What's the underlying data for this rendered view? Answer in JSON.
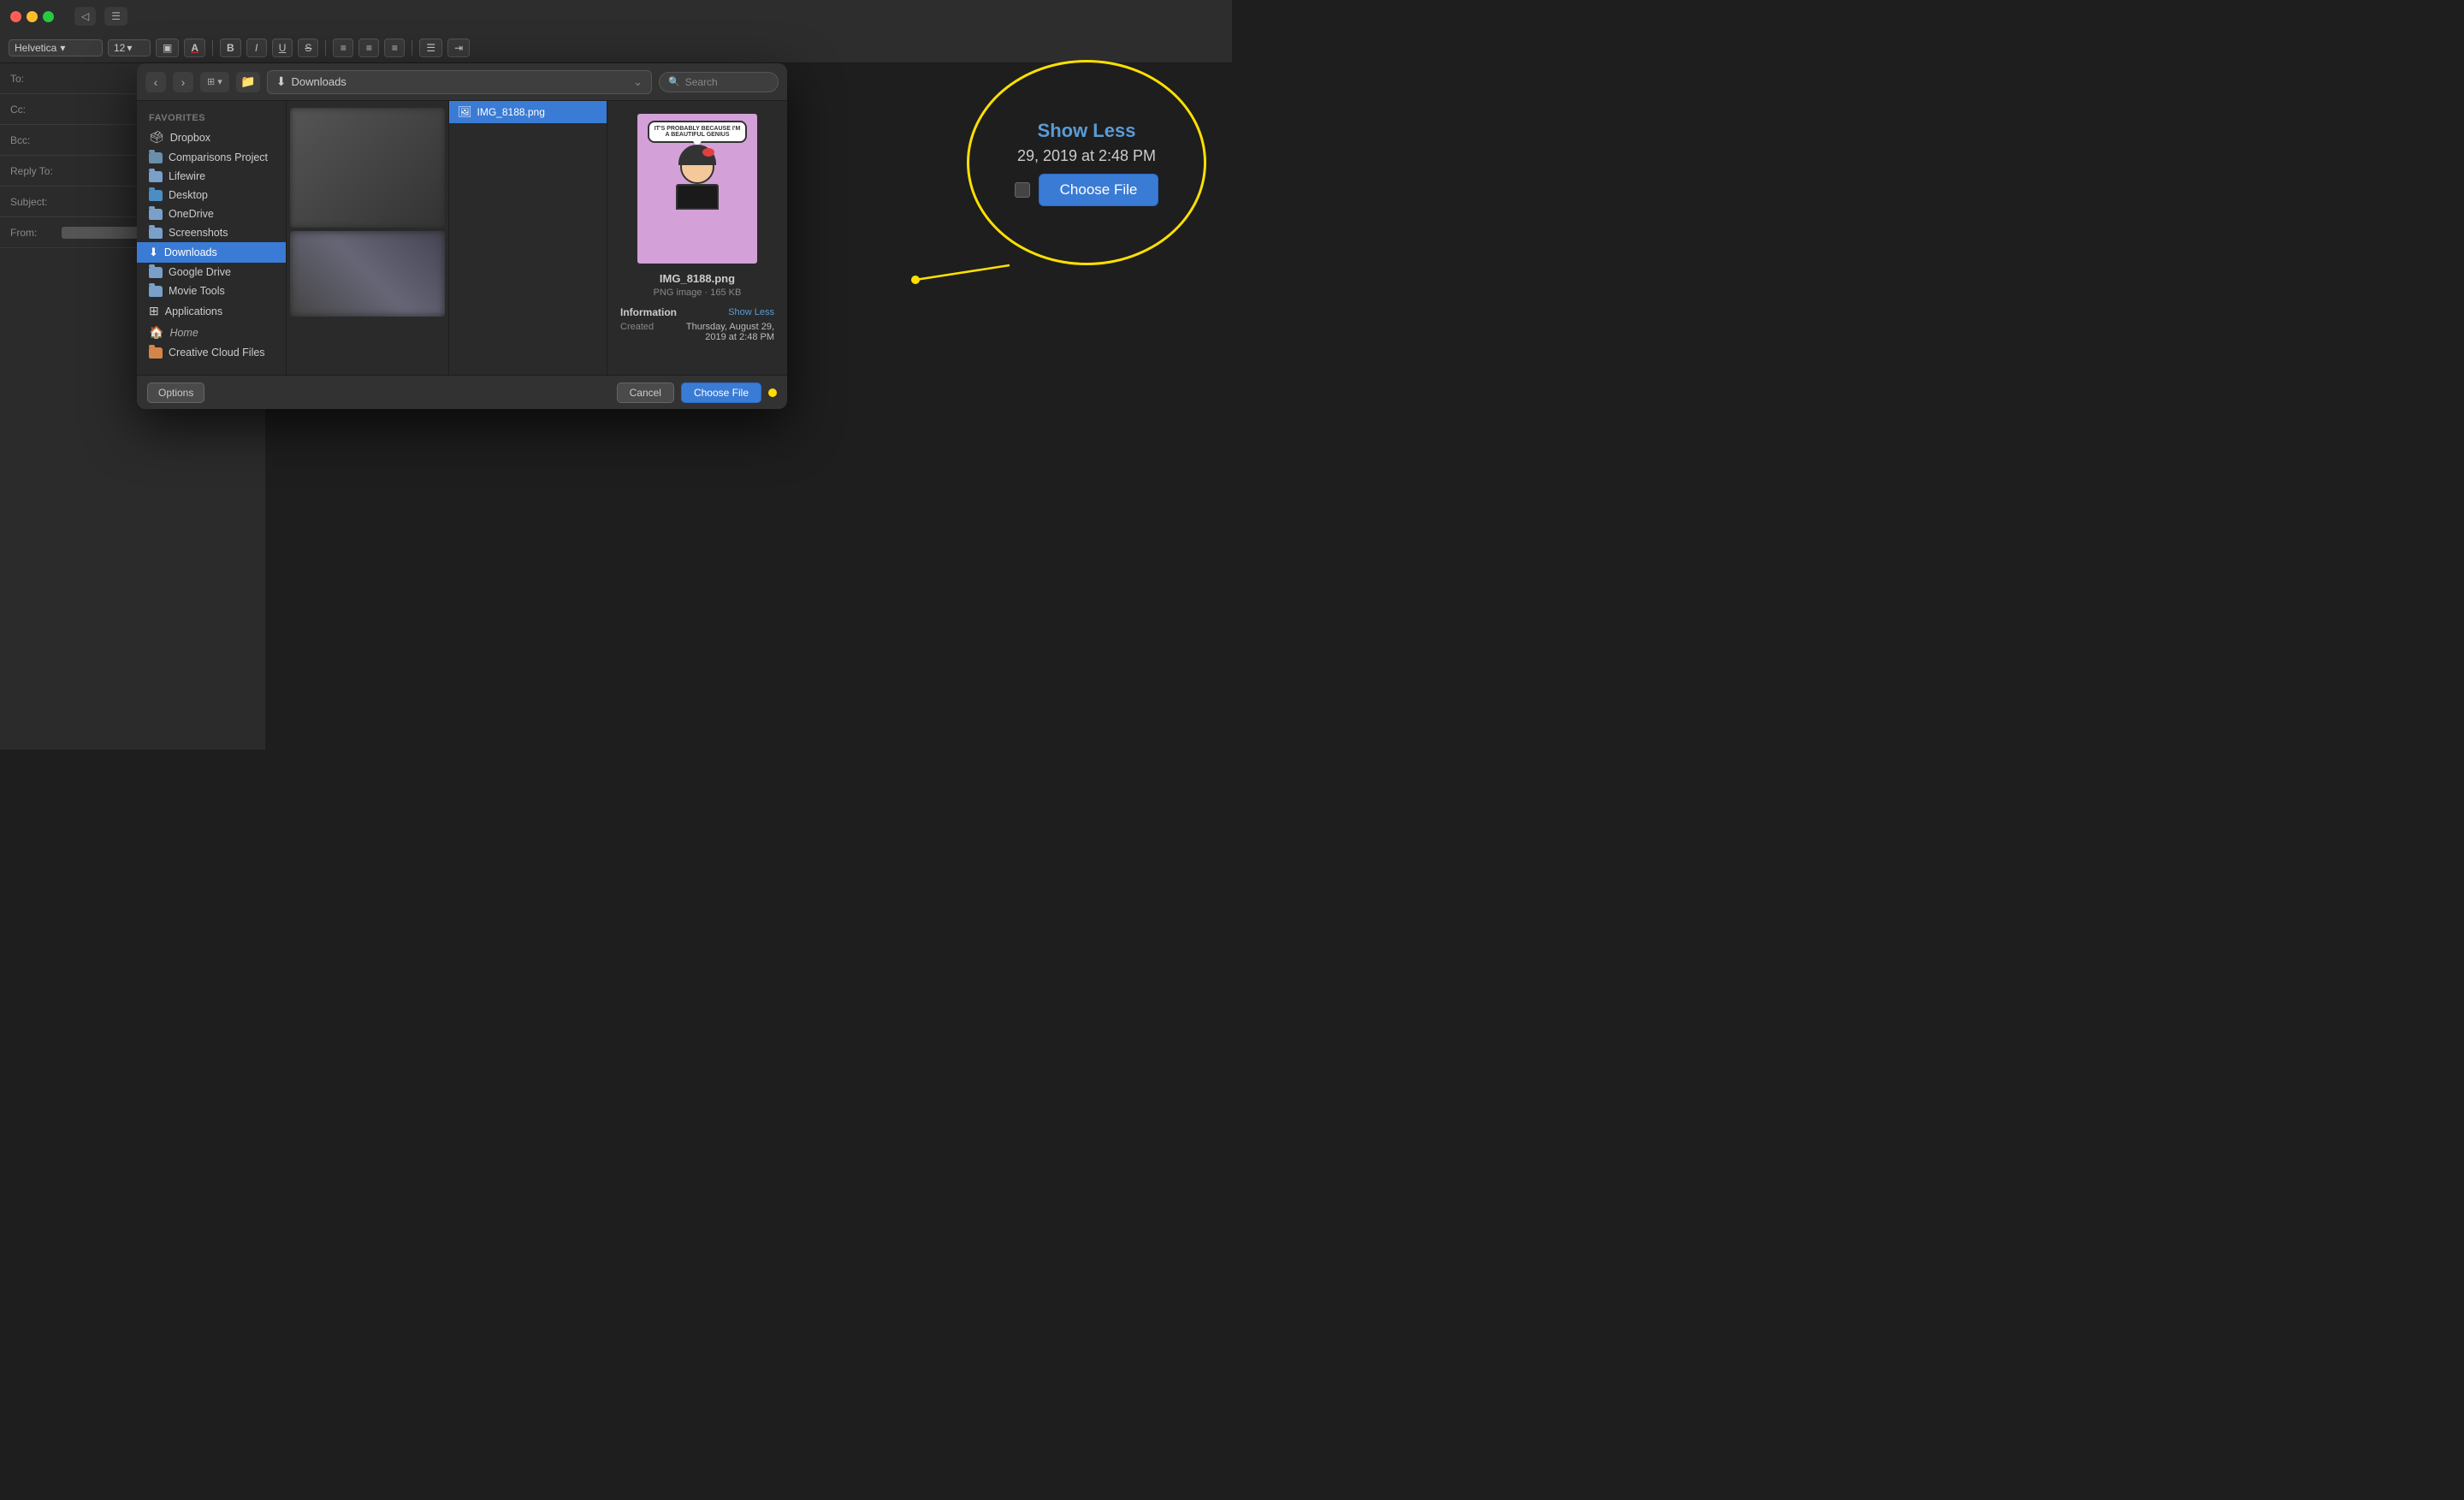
{
  "titlebar": {
    "traffic_lights": [
      "close",
      "minimize",
      "maximize"
    ],
    "icon_buttons": [
      "back",
      "list"
    ]
  },
  "toolbar": {
    "font": "Helvetica",
    "size": "12",
    "bold": "B",
    "italic": "I",
    "underline": "U",
    "strikethrough": "S",
    "align_left": "≡",
    "align_center": "≡",
    "align_right": "≡",
    "list_btn": "≡"
  },
  "compose": {
    "to_label": "To:",
    "cc_label": "Cc:",
    "bcc_label": "Bcc:",
    "reply_to_label": "Reply To:",
    "subject_label": "Subject:",
    "from_label": "From:"
  },
  "file_dialog": {
    "nav": {
      "back_label": "‹",
      "forward_label": "›",
      "view_label": "⊞",
      "folder_label": "📁"
    },
    "location_bar": {
      "icon": "⬇",
      "text": "Downloads",
      "chevron": "⌄"
    },
    "search": {
      "placeholder": "Search",
      "icon": "🔍"
    },
    "sidebar": {
      "section_label": "Favorites",
      "items": [
        {
          "id": "dropbox",
          "label": "Dropbox",
          "icon": "dropbox"
        },
        {
          "id": "comparisons",
          "label": "Comparisons Project",
          "icon": "folder"
        },
        {
          "id": "lifewire",
          "label": "Lifewire",
          "icon": "folder"
        },
        {
          "id": "desktop",
          "label": "Desktop",
          "icon": "folder"
        },
        {
          "id": "onedrive",
          "label": "OneDrive",
          "icon": "folder"
        },
        {
          "id": "screenshots",
          "label": "Screenshots",
          "icon": "folder"
        },
        {
          "id": "downloads",
          "label": "Downloads",
          "icon": "downloads",
          "active": true
        },
        {
          "id": "googledrive",
          "label": "Google Drive",
          "icon": "folder"
        },
        {
          "id": "movietools",
          "label": "Movie Tools",
          "icon": "folder"
        },
        {
          "id": "applications",
          "label": "Applications",
          "icon": "applications"
        },
        {
          "id": "home",
          "label": "Home",
          "icon": "home"
        },
        {
          "id": "creative",
          "label": "Creative Cloud Files",
          "icon": "folder"
        }
      ]
    },
    "file_list": {
      "files": [
        {
          "id": "img8188",
          "name": "IMG_8188.png",
          "selected": true
        }
      ]
    },
    "preview": {
      "filename": "IMG_8188.png",
      "fileinfo": "PNG image · 165 KB",
      "speech_text": "IT'S PROBABLY BECAUSE I'M A BEAUTIFUL GENIUS",
      "info_section": {
        "label": "Information",
        "show_less_label": "Show Less",
        "created_label": "Created",
        "created_value": "Thursday, August 29, 2019 at 2:48 PM"
      }
    },
    "footer": {
      "options_label": "Options",
      "cancel_label": "Cancel",
      "choose_label": "Choose File"
    }
  },
  "callout": {
    "show_less_label": "Show Less",
    "date_text": "29, 2019 at 2:48 PM",
    "choose_label": "Choose File"
  }
}
